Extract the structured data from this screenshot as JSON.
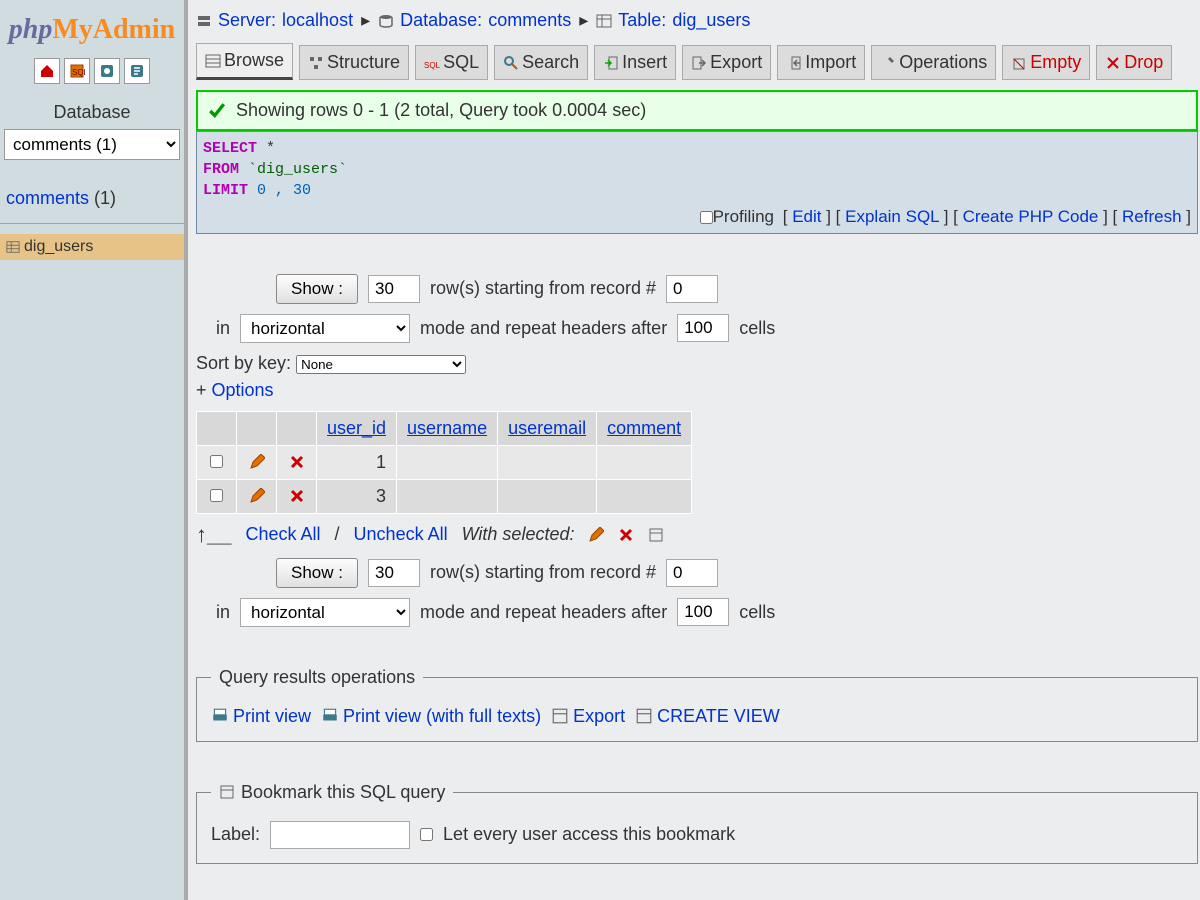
{
  "logo": {
    "php": "php",
    "my": "My",
    "admin": "Admin"
  },
  "sidebar": {
    "db_label": "Database",
    "db_selected": "comments (1)",
    "db_link_text": "comments",
    "db_link_count": "(1)",
    "table_name": "dig_users"
  },
  "breadcrumb": {
    "server_label": "Server:",
    "server_value": "localhost",
    "db_label": "Database:",
    "db_value": "comments",
    "table_label": "Table:",
    "table_value": "dig_users"
  },
  "tabs": {
    "browse": "Browse",
    "structure": "Structure",
    "sql": "SQL",
    "search": "Search",
    "insert": "Insert",
    "export": "Export",
    "import": "Import",
    "operations": "Operations",
    "empty": "Empty",
    "drop": "Drop"
  },
  "success": "Showing rows 0 - 1 (2 total, Query took 0.0004 sec)",
  "sql": {
    "select": "SELECT",
    "star": " *",
    "from": "FROM",
    "table": " `dig_users`",
    "limit": "LIMIT",
    "nums": " 0 , 30",
    "profiling": "Profiling",
    "edit": "Edit",
    "explain": "Explain SQL",
    "php": "Create PHP Code",
    "refresh": "Refresh"
  },
  "controls": {
    "show_btn": "Show :",
    "rows_value": "30",
    "rows_text_mid": "row(s) starting from record #",
    "start_value": "0",
    "in_text": "in",
    "mode_value": "horizontal",
    "mode_text_mid": "mode and repeat headers after",
    "repeat_value": "100",
    "cells_text": "cells",
    "sort_label": "Sort by key:",
    "sort_value": "None",
    "options": "+ ",
    "options_link": "Options"
  },
  "table": {
    "headers": [
      "user_id",
      "username",
      "useremail",
      "comment"
    ],
    "rows": [
      {
        "user_id": "1",
        "username": "",
        "useremail": "",
        "comment": ""
      },
      {
        "user_id": "3",
        "username": "",
        "useremail": "",
        "comment": ""
      }
    ]
  },
  "checkrow": {
    "check_all": "Check All",
    "uncheck_all": "Uncheck All",
    "with_selected": "With selected:"
  },
  "ops": {
    "legend": "Query results operations",
    "print": "Print view",
    "print_full": "Print view (with full texts)",
    "export": "Export",
    "create_view": "CREATE VIEW"
  },
  "bookmark": {
    "legend": "Bookmark this SQL query",
    "label": "Label:",
    "let_every": "Let every user access this bookmark"
  }
}
